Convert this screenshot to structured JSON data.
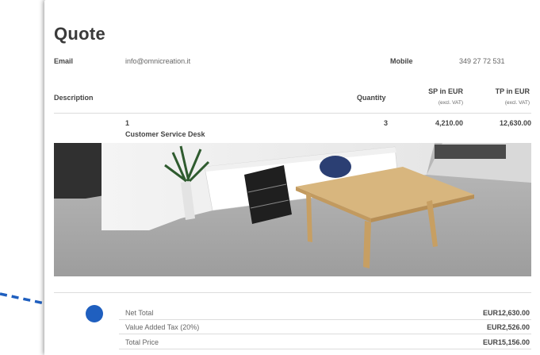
{
  "quote": {
    "title": "Quote",
    "email_label": "Email",
    "email_value": "info@omnicreation.it",
    "mobile_label": "Mobile",
    "mobile_value": "349 27 72 531"
  },
  "table": {
    "headers": {
      "description": "Description",
      "quantity": "Quantity",
      "sp": "SP in EUR",
      "sp_sub": "(excl. VAT)",
      "tp": "TP in EUR",
      "tp_sub": "(excl. VAT)"
    },
    "rows": [
      {
        "index": "1",
        "name": "Customer Service Desk",
        "quantity": "3",
        "sp": "4,210.00",
        "tp": "12,630.00"
      }
    ]
  },
  "totals": [
    {
      "label": "Net Total",
      "value": "EUR12,630.00"
    },
    {
      "label": "Value Added Tax (20%)",
      "value": "EUR2,526.00"
    },
    {
      "label": "Total Price",
      "value": "EUR15,156.00"
    }
  ],
  "colors": {
    "accent_dot": "#1f5fbf"
  }
}
